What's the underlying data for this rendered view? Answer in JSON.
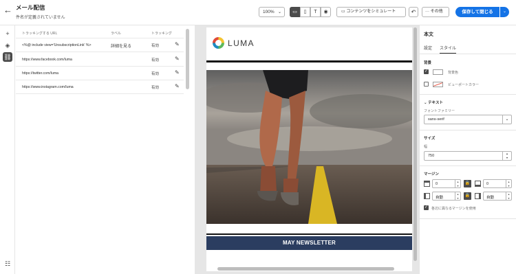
{
  "header": {
    "title": "メール配信",
    "subtitle": "件名が定義されていません",
    "zoom": "100%",
    "simulate_label": "コンテンツをシミュレート",
    "more_label": "その他",
    "save_label": "保存して閉じる"
  },
  "links": {
    "columns": {
      "url": "トラッキングする URL",
      "label": "ラベル",
      "tracking": "トラッキング"
    },
    "rows": [
      {
        "url": "<%@ include view='UnsubscriptionLink' %>",
        "label": "詳細を見る",
        "tracking": "有効"
      },
      {
        "url": "https://www.facebook.com/luma",
        "label": "",
        "tracking": "有効"
      },
      {
        "url": "https://twitter.com/luma",
        "label": "",
        "tracking": "有効"
      },
      {
        "url": "https://www.instagram.com/luma",
        "label": "",
        "tracking": "有効"
      }
    ]
  },
  "email": {
    "brand": "LUMA",
    "newsletter_heading": "MAY NEWSLETTER"
  },
  "props": {
    "title": "本文",
    "tabs": [
      "設定",
      "スタイル"
    ],
    "background_section": "背景",
    "background_color_label": "背景色",
    "viewport_color_label": "ビューポートカラー",
    "text_section": "テキスト",
    "font_family_label": "フォントファミリー",
    "font_family_value": "sans-serif",
    "size_section": "サイズ",
    "width_label": "幅",
    "width_value": "750",
    "margin_section": "マージン",
    "margin_top": "0",
    "margin_bottom": "0",
    "margin_left": "自動",
    "margin_right": "自動",
    "different_margins_label": "各辺に異なるマージンを使用"
  },
  "colors": {
    "accent": "#1473e6",
    "newsletter_bar": "#2b3d60"
  }
}
